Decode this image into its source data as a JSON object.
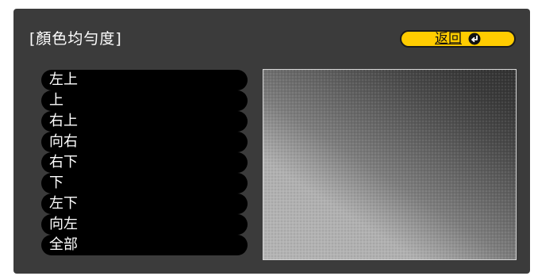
{
  "header": {
    "title": "[顏色均勻度]"
  },
  "back_button": {
    "label": "返回",
    "icon": "enter-arrow-icon",
    "color": "#ffcc00"
  },
  "menu": {
    "items": [
      {
        "label": "左上"
      },
      {
        "label": "上"
      },
      {
        "label": "右上"
      },
      {
        "label": "向右"
      },
      {
        "label": "右下"
      },
      {
        "label": "下"
      },
      {
        "label": "左下"
      },
      {
        "label": "向左"
      },
      {
        "label": "全部"
      }
    ]
  },
  "colors": {
    "panel_background": "#3b3b3b",
    "menu_item_background": "#000000",
    "menu_text": "#ffffff",
    "accent": "#ffcc00"
  },
  "preview": {
    "type": "grayscale-diagonal-gradient"
  }
}
